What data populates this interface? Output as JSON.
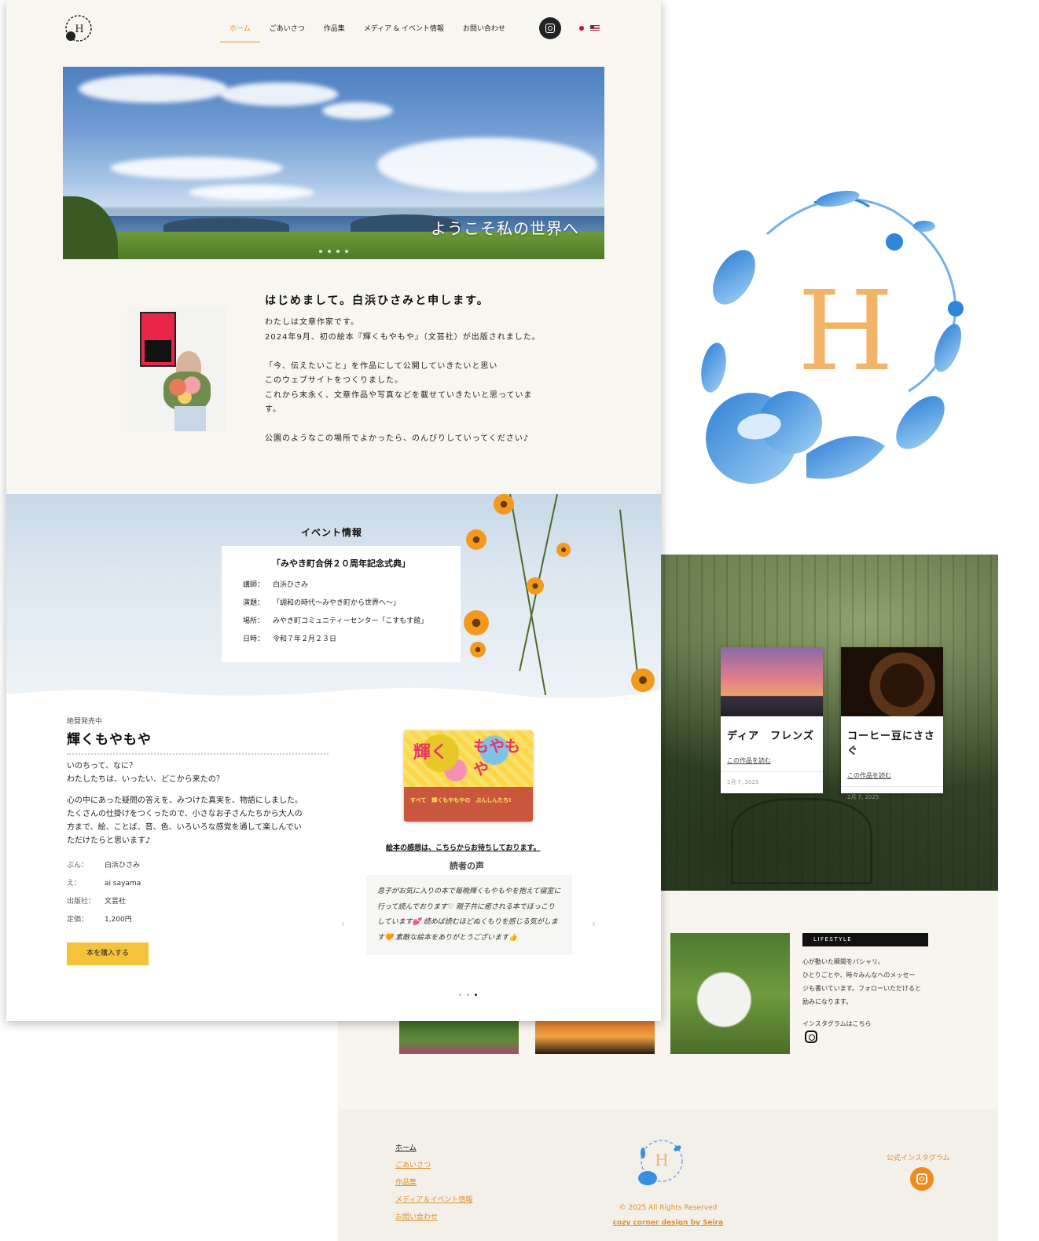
{
  "nav": {
    "items": [
      "ホーム",
      "ごあいさつ",
      "作品集",
      "メディア & イベント情報",
      "お問い合わせ"
    ],
    "active_index": 0
  },
  "brand": {
    "logo_letter": "H",
    "accent_color": "#e0902a",
    "logo_blue": "#2f86d8"
  },
  "hero": {
    "caption": "ようこそ私の世界へ",
    "slides_count": 4
  },
  "intro": {
    "title": "はじめまして。白浜ひさみと申します。",
    "body": "わたしは文章作家です。\n2024年9月、初の絵本『輝くもやもや』（文芸社）が出版されました。\n\n「今、伝えたいこと」を作品にして公開していきたいと思い\nこのウェブサイトをつくりました。\nこれから末永く、文章作品や写真などを載せていきたいと思っていま\nす。\n\n公園のようなこの場所でよかったら、のんびりしていってください♪"
  },
  "event": {
    "heading": "イベント情報",
    "title": "「みやき町合併２０周年記念式典」",
    "rows": [
      {
        "key": "講師：",
        "value": "白浜ひさみ"
      },
      {
        "key": "演題：",
        "value": "「調和の時代〜みやき町から世界へ〜」"
      },
      {
        "key": "場所：",
        "value": "みやき町コミュニティーセンター「こすもす館」"
      },
      {
        "key": "日時：",
        "value": "令和７年２月２３日"
      }
    ]
  },
  "book": {
    "sale_label": "絶賛発売中",
    "title": "輝くもやもや",
    "p1": "いのちって、なに？\nわたしたちは、いったい、どこから来たの？",
    "p2": "心の中にあった疑問の答えを、みつけた真実を、物語にしました。\nたくさんの仕掛けをつくったので、小さなお子さんたちから大人の\n方まで、絵、ことば、音、色、いろいろな感覚を通して楽しんでい\nただけたらと思います♪",
    "meta": [
      {
        "key": "ぶん：",
        "value": "白浜ひさみ"
      },
      {
        "key": "え：",
        "value": "ai sayama"
      },
      {
        "key": "出版社：",
        "value": "文芸社"
      },
      {
        "key": "定価：",
        "value": "1,200円"
      }
    ],
    "buy_label": "本を購入する",
    "cover_title_1": "輝く",
    "cover_title_2": "もやもや",
    "cover_subtitle": "すべて　輝くもやもやの　ぶんしんたち!",
    "impression_link": "絵本の感想は、こちらからお待ちしております。",
    "reviews_heading": "読者の声",
    "review_text": "息子がお気に入りの本で毎晩輝くもやもやを抱えて寝室に行って読んでおります♡ 親子共に癒される本でほっこりしています💕 読めば読むほどぬくもりを感じる気がします🧡 素敵な絵本をありがとうございます👍",
    "review_dots": 3,
    "review_active": 2
  },
  "works": [
    {
      "title": "ディア　フレンズ",
      "link": "この作品を読む",
      "date": "2月 7, 2025"
    },
    {
      "title": "コーヒー豆にささぐ",
      "link": "この作品を読む",
      "date": "2月 7, 2025"
    }
  ],
  "lifestyle": {
    "badge": "LIFESTYLE",
    "text": "心が動いた瞬間をパシャリ。\nひとりごとや、時々みんなへのメッセー\nジも書いています。フォローいただけると\n励みになります。",
    "insta_label": "インスタグラムはこちら"
  },
  "footer": {
    "nav": [
      "ホーム",
      "ごあいさつ",
      "作品集",
      "メディア＆イベント情報",
      "お問い合わせ"
    ],
    "copyright": "© 2025 All Rights Reserved",
    "designer": "cozy corner design by Seira",
    "insta_label": "公式インスタグラム"
  }
}
